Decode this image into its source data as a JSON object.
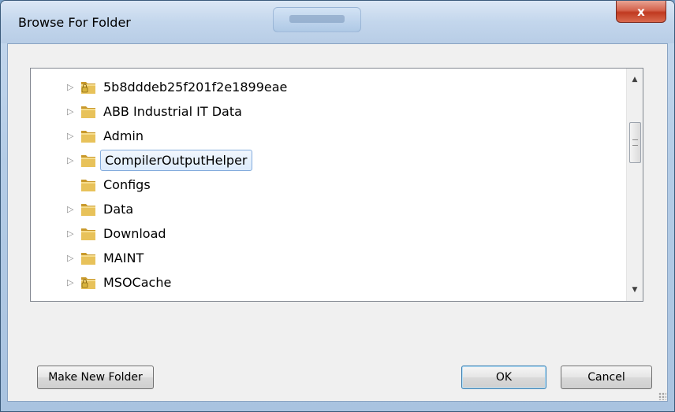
{
  "window": {
    "title": "Browse For Folder",
    "close_glyph": "x"
  },
  "tree": {
    "items": [
      {
        "label": "5b8dddeb25f201f2e1899eae",
        "expandable": true,
        "locked": true,
        "selected": false
      },
      {
        "label": "ABB Industrial IT Data",
        "expandable": true,
        "locked": false,
        "selected": false
      },
      {
        "label": "Admin",
        "expandable": true,
        "locked": false,
        "selected": false
      },
      {
        "label": "CompilerOutputHelper",
        "expandable": true,
        "locked": false,
        "selected": true
      },
      {
        "label": "Configs",
        "expandable": false,
        "locked": false,
        "selected": false
      },
      {
        "label": "Data",
        "expandable": true,
        "locked": false,
        "selected": false
      },
      {
        "label": "Download",
        "expandable": true,
        "locked": false,
        "selected": false
      },
      {
        "label": "MAINT",
        "expandable": true,
        "locked": false,
        "selected": false
      },
      {
        "label": "MSOCache",
        "expandable": true,
        "locked": true,
        "selected": false
      }
    ],
    "expander_glyph": "▷",
    "scroll_up_glyph": "▲",
    "scroll_down_glyph": "▼"
  },
  "buttons": {
    "make_new_folder": "Make New Folder",
    "ok": "OK",
    "cancel": "Cancel"
  },
  "colors": {
    "folder": "#e8c25a",
    "folder_dark": "#c9992b",
    "lock": "#d8b33c",
    "selection_border": "#84acdd"
  }
}
